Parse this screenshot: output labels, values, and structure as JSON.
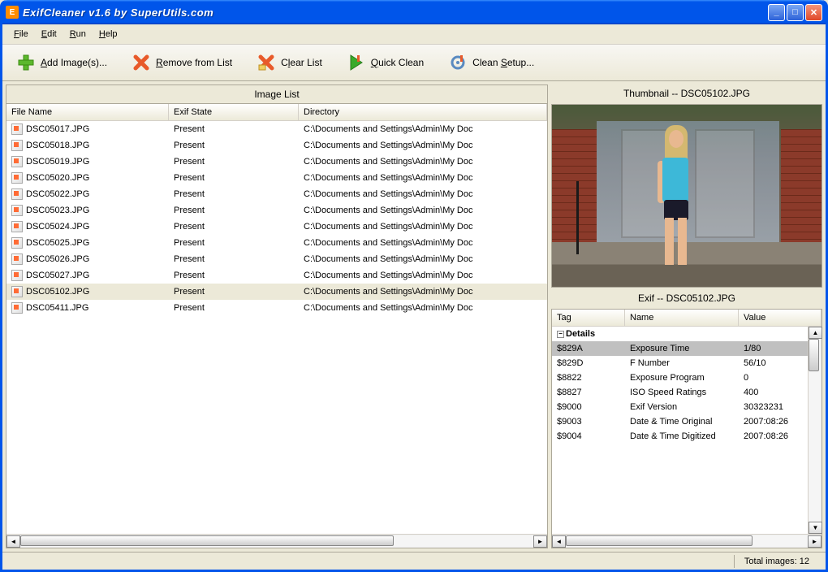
{
  "window": {
    "title": "ExifCleaner v1.6 by SuperUtils.com"
  },
  "menu": {
    "file": "File",
    "edit": "Edit",
    "run": "Run",
    "help": "Help"
  },
  "toolbar": {
    "addImages": "Add Image(s)...",
    "removeFromList": "Remove from List",
    "clearList": "Clear List",
    "quickClean": "Quick Clean",
    "cleanSetup": "Clean Setup..."
  },
  "panels": {
    "imageListTitle": "Image List",
    "thumbnailTitle": "Thumbnail -- DSC05102.JPG",
    "exifTitle": "Exif -- DSC05102.JPG"
  },
  "imageList": {
    "columns": {
      "fileName": "File Name",
      "exifState": "Exif State",
      "directory": "Directory"
    },
    "rows": [
      {
        "file": "DSC05017.JPG",
        "state": "Present",
        "dir": "C:\\Documents and Settings\\Admin\\My Doc",
        "selected": false
      },
      {
        "file": "DSC05018.JPG",
        "state": "Present",
        "dir": "C:\\Documents and Settings\\Admin\\My Doc",
        "selected": false
      },
      {
        "file": "DSC05019.JPG",
        "state": "Present",
        "dir": "C:\\Documents and Settings\\Admin\\My Doc",
        "selected": false
      },
      {
        "file": "DSC05020.JPG",
        "state": "Present",
        "dir": "C:\\Documents and Settings\\Admin\\My Doc",
        "selected": false
      },
      {
        "file": "DSC05022.JPG",
        "state": "Present",
        "dir": "C:\\Documents and Settings\\Admin\\My Doc",
        "selected": false
      },
      {
        "file": "DSC05023.JPG",
        "state": "Present",
        "dir": "C:\\Documents and Settings\\Admin\\My Doc",
        "selected": false
      },
      {
        "file": "DSC05024.JPG",
        "state": "Present",
        "dir": "C:\\Documents and Settings\\Admin\\My Doc",
        "selected": false
      },
      {
        "file": "DSC05025.JPG",
        "state": "Present",
        "dir": "C:\\Documents and Settings\\Admin\\My Doc",
        "selected": false
      },
      {
        "file": "DSC05026.JPG",
        "state": "Present",
        "dir": "C:\\Documents and Settings\\Admin\\My Doc",
        "selected": false
      },
      {
        "file": "DSC05027.JPG",
        "state": "Present",
        "dir": "C:\\Documents and Settings\\Admin\\My Doc",
        "selected": false
      },
      {
        "file": "DSC05102.JPG",
        "state": "Present",
        "dir": "C:\\Documents and Settings\\Admin\\My Doc",
        "selected": true
      },
      {
        "file": "DSC05411.JPG",
        "state": "Present",
        "dir": "C:\\Documents and Settings\\Admin\\My Doc",
        "selected": false
      }
    ]
  },
  "exif": {
    "columns": {
      "tag": "Tag",
      "name": "Name",
      "value": "Value"
    },
    "group": "Details",
    "rows": [
      {
        "tag": "$829A",
        "name": "Exposure Time",
        "value": "1/80",
        "selected": true
      },
      {
        "tag": "$829D",
        "name": "F Number",
        "value": "56/10",
        "selected": false
      },
      {
        "tag": "$8822",
        "name": "Exposure Program",
        "value": "0",
        "selected": false
      },
      {
        "tag": "$8827",
        "name": "ISO Speed Ratings",
        "value": "400",
        "selected": false
      },
      {
        "tag": "$9000",
        "name": "Exif Version",
        "value": "30323231",
        "selected": false
      },
      {
        "tag": "$9003",
        "name": "Date & Time Original",
        "value": "2007:08:26",
        "selected": false
      },
      {
        "tag": "$9004",
        "name": "Date & Time Digitized",
        "value": "2007:08:26",
        "selected": false
      }
    ]
  },
  "status": {
    "totalImages": "Total images: 12"
  }
}
